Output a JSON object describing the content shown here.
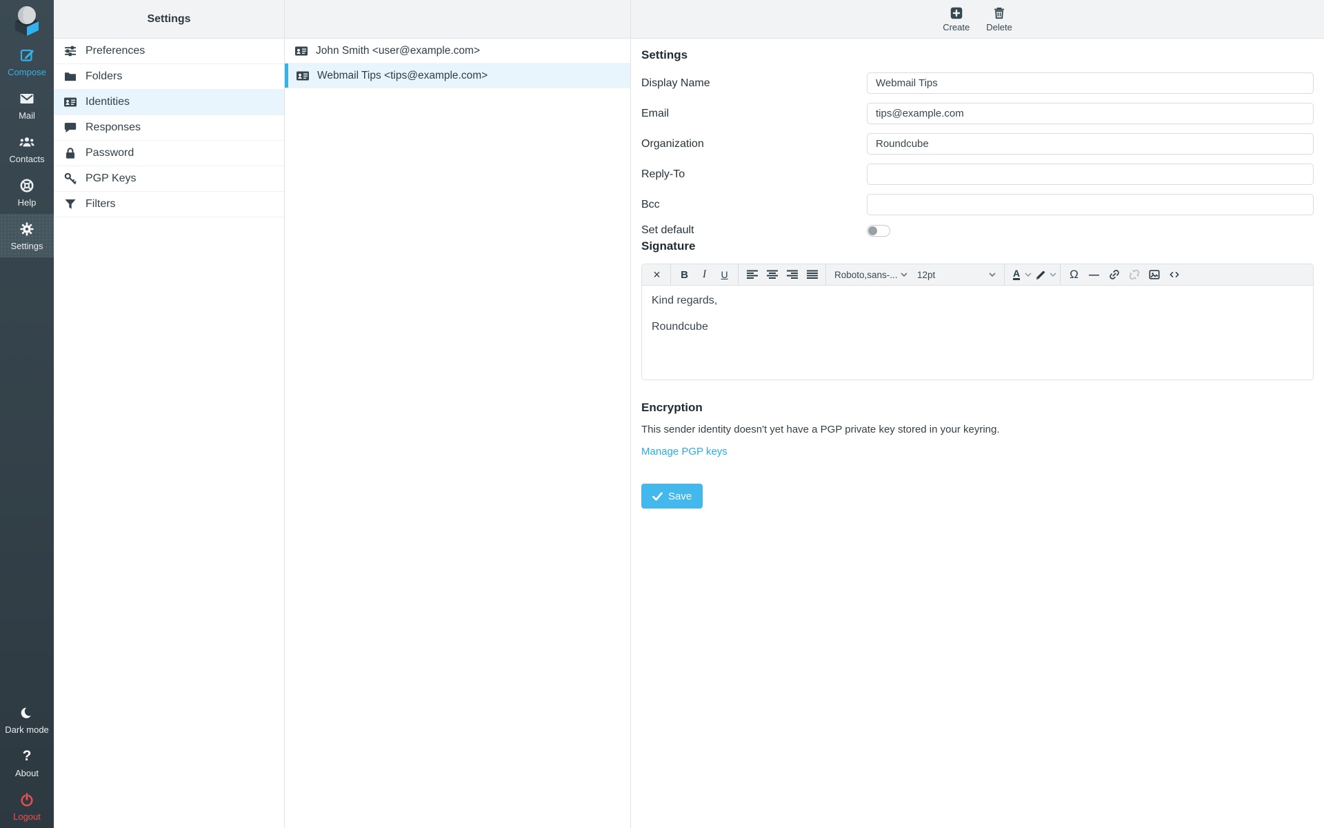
{
  "colors": {
    "accent": "#32b2e9",
    "save_button": "#42b8ec",
    "logout_red": "#ef5050",
    "sidebar_bg": "#37474f",
    "selection_bg": "#e9f5fc",
    "header_bg": "#f2f3f4"
  },
  "sidebar": {
    "items": [
      {
        "label": "Compose"
      },
      {
        "label": "Mail"
      },
      {
        "label": "Contacts"
      },
      {
        "label": "Help"
      },
      {
        "label": "Settings"
      }
    ],
    "bottom_items": [
      {
        "label": "Dark mode"
      },
      {
        "label": "About"
      },
      {
        "label": "Logout"
      }
    ]
  },
  "menu": {
    "header": "Settings",
    "items": [
      {
        "label": "Preferences"
      },
      {
        "label": "Folders"
      },
      {
        "label": "Identities"
      },
      {
        "label": "Responses"
      },
      {
        "label": "Password"
      },
      {
        "label": "PGP Keys"
      },
      {
        "label": "Filters"
      }
    ]
  },
  "identities": {
    "rows": [
      {
        "text": "John Smith <user@example.com>"
      },
      {
        "text": "Webmail Tips <tips@example.com>"
      }
    ]
  },
  "header_actions": {
    "create": "Create",
    "delete": "Delete"
  },
  "form": {
    "section_title": "Settings",
    "fields": {
      "display_name": {
        "label": "Display Name",
        "value": "Webmail Tips"
      },
      "email": {
        "label": "Email",
        "value": "tips@example.com"
      },
      "organization": {
        "label": "Organization",
        "value": "Roundcube"
      },
      "reply_to": {
        "label": "Reply-To",
        "value": ""
      },
      "bcc": {
        "label": "Bcc",
        "value": ""
      }
    },
    "set_default_label": "Set default"
  },
  "signature": {
    "title": "Signature",
    "toolbar": {
      "font_family": "Roboto,sans-...",
      "font_size": "12pt",
      "icons": {
        "close": "×",
        "bold": "B",
        "italic": "I",
        "underline": "U",
        "forecolor": "A",
        "charmap": "Ω",
        "hr": "—"
      }
    },
    "lines": [
      "Kind regards,",
      "Roundcube"
    ]
  },
  "encryption": {
    "title": "Encryption",
    "message": "This sender identity doesn't yet have a PGP private key stored in your keyring.",
    "link": "Manage PGP keys"
  },
  "save": {
    "label": "Save"
  }
}
